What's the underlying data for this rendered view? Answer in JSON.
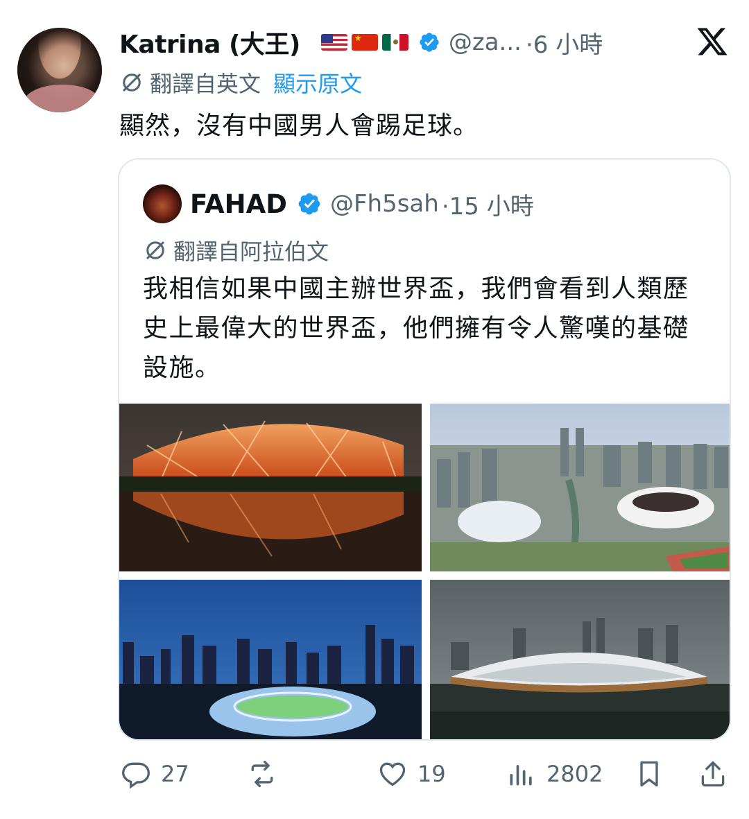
{
  "author": {
    "display_name": "Katrina (大王)",
    "flags": [
      "us-flag-icon",
      "cn-flag-icon",
      "mx-flag-icon"
    ],
    "handle": "@za...",
    "time": "·6 小時"
  },
  "translation": {
    "label": "翻譯自英文",
    "show_original": "顯示原文"
  },
  "tweet_text": "顯然，沒有中國男人會踢足球。",
  "quote": {
    "display_name": "FAHAD",
    "handle": "@Fh5sah",
    "time": "·15 小時",
    "translation_label": "翻譯自阿拉伯文",
    "text": "我相信如果中國主辦世界盃，我們會看到人類歷史上最偉大的世界盃，他們擁有令人驚嘆的基礎設施。"
  },
  "actions": {
    "replies": "27",
    "retweets": "",
    "likes": "19",
    "views": "2802"
  },
  "colors": {
    "accent": "#1d9bf0",
    "secondary_text": "#536471",
    "border": "#e1e8ed"
  }
}
